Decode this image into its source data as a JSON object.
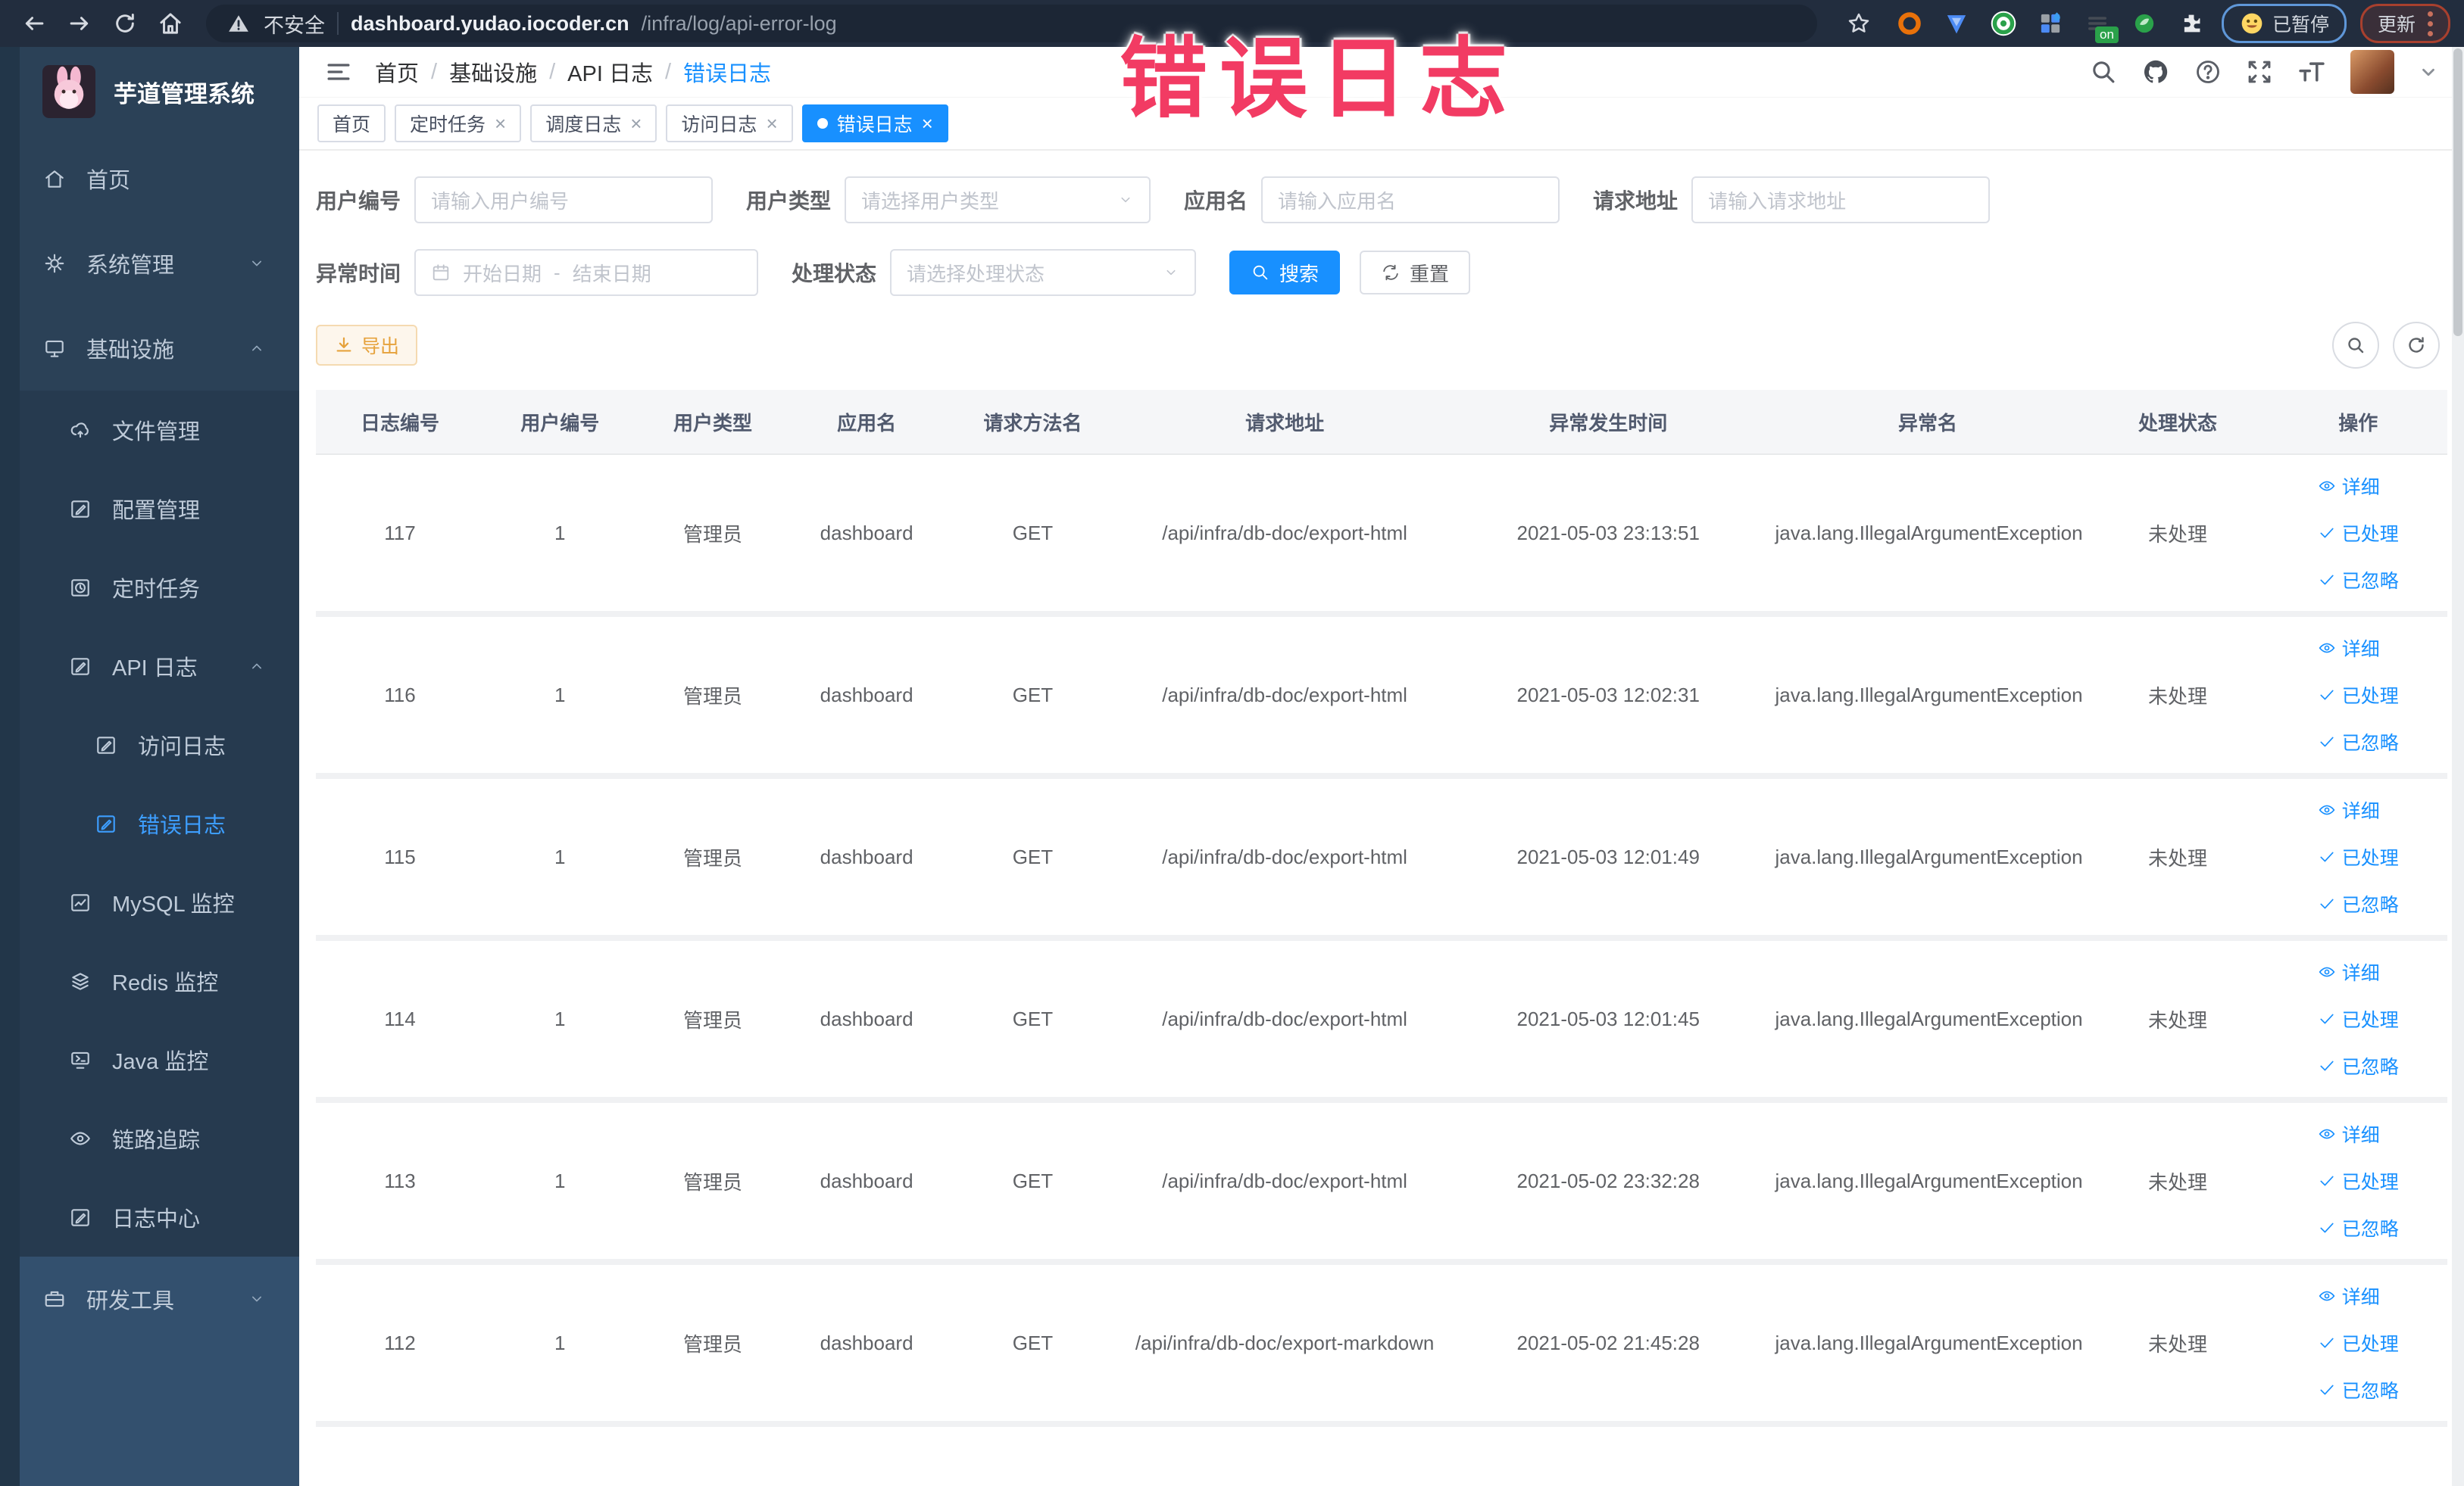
{
  "browser": {
    "security_label": "不安全",
    "url_host": "dashboard.yudao.iocoder.cn",
    "url_path": "/infra/log/api-error-log",
    "extension_on_badge": "on",
    "paused_badge": "已暂停",
    "update_badge": "更新"
  },
  "overlay": {
    "text": "错误日志",
    "color": "#f23b63"
  },
  "sidebar": {
    "title": "芋道管理系统",
    "items": [
      {
        "key": "home",
        "label": "首页",
        "icon": "home",
        "level": 1
      },
      {
        "key": "system-management",
        "label": "系统管理",
        "icon": "gear",
        "level": 1,
        "arrow": "down"
      },
      {
        "key": "infrastructure",
        "label": "基础设施",
        "icon": "monitor",
        "level": 1,
        "arrow": "up"
      },
      {
        "key": "file-management",
        "label": "文件管理",
        "icon": "cloud",
        "level": 2,
        "submenu": true
      },
      {
        "key": "config-management",
        "label": "配置管理",
        "icon": "edit",
        "level": 2,
        "submenu": true
      },
      {
        "key": "scheduled-tasks",
        "label": "定时任务",
        "icon": "clock",
        "level": 2,
        "submenu": true
      },
      {
        "key": "api-log",
        "label": "API 日志",
        "icon": "doc",
        "level": 2,
        "submenu": true,
        "arrow": "up"
      },
      {
        "key": "access-log",
        "label": "访问日志",
        "icon": "doc",
        "level": 3,
        "submenu": true
      },
      {
        "key": "error-log",
        "label": "错误日志",
        "icon": "doc",
        "level": 3,
        "submenu": true,
        "active": true
      },
      {
        "key": "mysql-monitor",
        "label": "MySQL 监控",
        "icon": "chart",
        "level": 2,
        "submenu": true
      },
      {
        "key": "redis-monitor",
        "label": "Redis 监控",
        "icon": "layers",
        "level": 2,
        "submenu": true
      },
      {
        "key": "java-monitor",
        "label": "Java 监控",
        "icon": "terminal",
        "level": 2,
        "submenu": true
      },
      {
        "key": "trace",
        "label": "链路追踪",
        "icon": "eye",
        "level": 2,
        "submenu": true
      },
      {
        "key": "log-center",
        "label": "日志中心",
        "icon": "edit",
        "level": 2,
        "submenu": true
      },
      {
        "key": "dev-tools",
        "label": "研发工具",
        "icon": "tool",
        "level": 1,
        "arrow": "down",
        "light": true
      }
    ]
  },
  "header": {
    "breadcrumb": [
      "首页",
      "基础设施",
      "API 日志",
      "错误日志"
    ]
  },
  "tabs": [
    {
      "key": "home",
      "label": "首页",
      "closable": false
    },
    {
      "key": "scheduled-tasks",
      "label": "定时任务",
      "closable": true
    },
    {
      "key": "schedule-log",
      "label": "调度日志",
      "closable": true
    },
    {
      "key": "access-log",
      "label": "访问日志",
      "closable": true
    },
    {
      "key": "error-log",
      "label": "错误日志",
      "closable": true,
      "active": true
    }
  ],
  "filters": {
    "row1": [
      {
        "key": "user-id",
        "label": "用户编号",
        "placeholder": "请输入用户编号",
        "type": "input"
      },
      {
        "key": "user-type",
        "label": "用户类型",
        "placeholder": "请选择用户类型",
        "type": "select"
      },
      {
        "key": "app-name",
        "label": "应用名",
        "placeholder": "请输入应用名",
        "type": "input"
      },
      {
        "key": "request-url",
        "label": "请求地址",
        "placeholder": "请输入请求地址",
        "type": "input"
      }
    ],
    "daterange": {
      "key": "exception-time",
      "label": "异常时间",
      "start": "开始日期",
      "separator": "-",
      "end": "结束日期"
    },
    "status_select": {
      "key": "process-status",
      "label": "处理状态",
      "placeholder": "请选择处理状态"
    },
    "search_label": "搜索",
    "reset_label": "重置"
  },
  "toolbar": {
    "export_label": "导出"
  },
  "table": {
    "columns": [
      "日志编号",
      "用户编号",
      "用户类型",
      "应用名",
      "请求方法名",
      "请求地址",
      "异常发生时间",
      "异常名",
      "处理状态",
      "操作"
    ],
    "col_widths": [
      7.8,
      7.0,
      7.1,
      7.1,
      8.3,
      15.5,
      15.3,
      15.1,
      8.5,
      8.3
    ],
    "rows": [
      {
        "id": "117",
        "user_id": "1",
        "user_type": "管理员",
        "app": "dashboard",
        "method": "GET",
        "url": "/api/infra/db-doc/export-html",
        "time": "2021-05-03 23:13:51",
        "exception": "java.lang.IllegalArgumentException",
        "status": "未处理"
      },
      {
        "id": "116",
        "user_id": "1",
        "user_type": "管理员",
        "app": "dashboard",
        "method": "GET",
        "url": "/api/infra/db-doc/export-html",
        "time": "2021-05-03 12:02:31",
        "exception": "java.lang.IllegalArgumentException",
        "status": "未处理"
      },
      {
        "id": "115",
        "user_id": "1",
        "user_type": "管理员",
        "app": "dashboard",
        "method": "GET",
        "url": "/api/infra/db-doc/export-html",
        "time": "2021-05-03 12:01:49",
        "exception": "java.lang.IllegalArgumentException",
        "status": "未处理"
      },
      {
        "id": "114",
        "user_id": "1",
        "user_type": "管理员",
        "app": "dashboard",
        "method": "GET",
        "url": "/api/infra/db-doc/export-html",
        "time": "2021-05-03 12:01:45",
        "exception": "java.lang.IllegalArgumentException",
        "status": "未处理"
      },
      {
        "id": "113",
        "user_id": "1",
        "user_type": "管理员",
        "app": "dashboard",
        "method": "GET",
        "url": "/api/infra/db-doc/export-html",
        "time": "2021-05-02 23:32:28",
        "exception": "java.lang.IllegalArgumentException",
        "status": "未处理"
      },
      {
        "id": "112",
        "user_id": "1",
        "user_type": "管理员",
        "app": "dashboard",
        "method": "GET",
        "url": "/api/infra/db-doc/export-markdown",
        "time": "2021-05-02 21:45:28",
        "exception": "java.lang.IllegalArgumentException",
        "status": "未处理"
      }
    ],
    "row_actions": [
      {
        "key": "detail",
        "label": "详细",
        "icon": "eyesm"
      },
      {
        "key": "processed",
        "label": "已处理",
        "icon": "check"
      },
      {
        "key": "ignored",
        "label": "已忽略",
        "icon": "check"
      }
    ]
  },
  "colors": {
    "accent": "#1890ff",
    "chrome_bg": "#222d3e",
    "sidebar_bg": "#33506e",
    "menu_bg": "#2b4157",
    "submenu_bg": "#263a4f",
    "active_menu_text": "#3d9eff",
    "export_text": "#e6a23c",
    "export_bg": "#fdf6ec",
    "overlay_text": "#f23b63",
    "link": "#1890ff"
  }
}
